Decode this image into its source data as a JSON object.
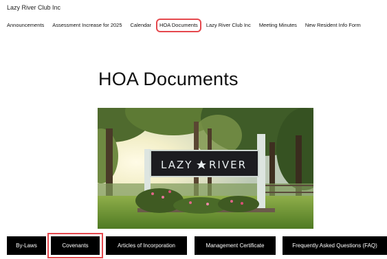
{
  "site": {
    "title": "Lazy River Club Inc"
  },
  "nav": {
    "items": [
      {
        "label": "Announcements"
      },
      {
        "label": "Assessment Increase for 2025"
      },
      {
        "label": "Calendar"
      },
      {
        "label": "HOA Documents"
      },
      {
        "label": "Lazy River Club Inc"
      },
      {
        "label": "Meeting Minutes"
      },
      {
        "label": "New Resident Info Form"
      }
    ]
  },
  "main": {
    "heading": "HOA Documents",
    "hero_sign_text": [
      "LAZY",
      "RIVER"
    ]
  },
  "documents": {
    "buttons": [
      {
        "label": "By-Laws"
      },
      {
        "label": "Covenants"
      },
      {
        "label": "Articles of Incorporation"
      },
      {
        "label": "Management Certificate"
      },
      {
        "label": "Frequently Asked Questions (FAQ)"
      }
    ]
  },
  "colors": {
    "highlight": "#e5484d",
    "button_bg": "#000000",
    "button_text": "#ffffff"
  }
}
